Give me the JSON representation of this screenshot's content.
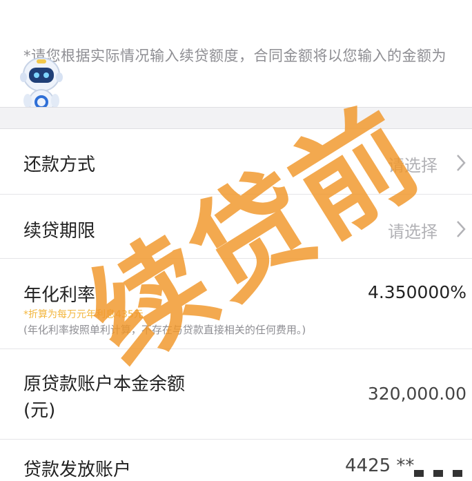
{
  "notice": {
    "text": "*请您根据实际情况输入续贷额度，合同金额将以您输入的金额为准。"
  },
  "rows": {
    "repay_method": {
      "label": "还款方式",
      "value": "请选择"
    },
    "term": {
      "label": "续贷期限",
      "value": "请选择"
    },
    "rate": {
      "label": "年化利率",
      "value": "4.350000%",
      "sub_orange": "*折算为每万元年利息435元",
      "sub_grey": "(年化利率按照单利计算，不存在与贷款直接相关的任何费用。)"
    },
    "principal": {
      "label_line1": "原贷款账户本金余额",
      "label_line2": "(元)",
      "value": "320,000.00"
    },
    "account": {
      "label": "贷款发放账户",
      "value": "4425 **"
    }
  },
  "watermark": {
    "text": "续贷前"
  },
  "icons": {
    "chevron": "chevron-right-icon",
    "mascot": "robot-mascot-icon"
  },
  "colors": {
    "watermark": "#f0962a",
    "accent_orange": "#f3b63d",
    "muted": "#8e8e93"
  }
}
